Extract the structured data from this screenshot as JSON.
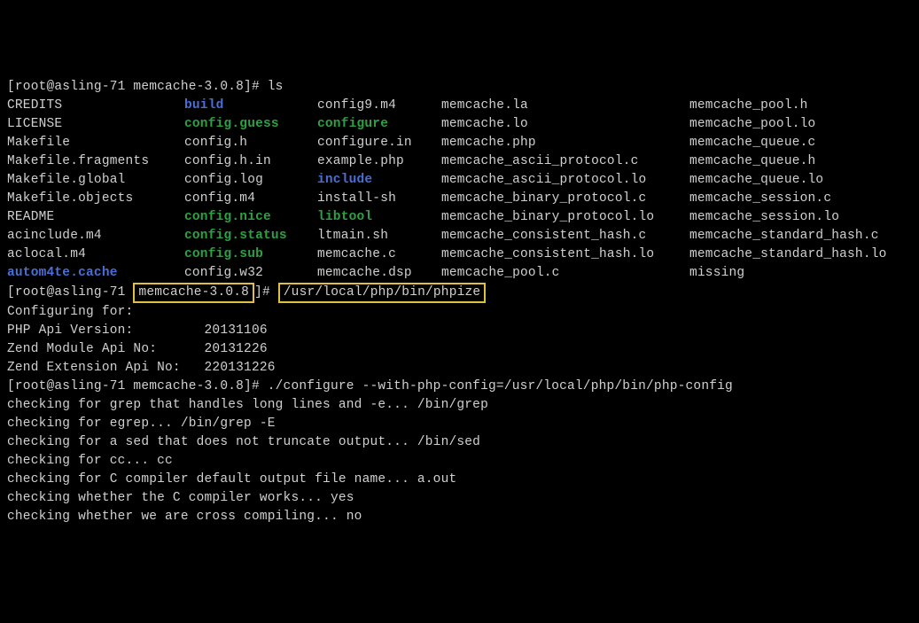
{
  "prompt1": {
    "user": "root",
    "host": "asling-71",
    "dir": "memcache-3.0.8",
    "cmd": "ls"
  },
  "ls": [
    [
      {
        "t": "CREDITS"
      },
      {
        "t": "build",
        "c": "blue"
      },
      {
        "t": "config9.m4"
      },
      {
        "t": "memcache.la"
      },
      {
        "t": "memcache_pool.h"
      }
    ],
    [
      {
        "t": "LICENSE"
      },
      {
        "t": "config.guess",
        "c": "green"
      },
      {
        "t": "configure",
        "c": "green"
      },
      {
        "t": "memcache.lo"
      },
      {
        "t": "memcache_pool.lo"
      }
    ],
    [
      {
        "t": "Makefile"
      },
      {
        "t": "config.h"
      },
      {
        "t": "configure.in"
      },
      {
        "t": "memcache.php"
      },
      {
        "t": "memcache_queue.c"
      }
    ],
    [
      {
        "t": "Makefile.fragments"
      },
      {
        "t": "config.h.in"
      },
      {
        "t": "example.php"
      },
      {
        "t": "memcache_ascii_protocol.c"
      },
      {
        "t": "memcache_queue.h"
      }
    ],
    [
      {
        "t": "Makefile.global"
      },
      {
        "t": "config.log"
      },
      {
        "t": "include",
        "c": "blue"
      },
      {
        "t": "memcache_ascii_protocol.lo"
      },
      {
        "t": "memcache_queue.lo"
      }
    ],
    [
      {
        "t": "Makefile.objects"
      },
      {
        "t": "config.m4"
      },
      {
        "t": "install-sh"
      },
      {
        "t": "memcache_binary_protocol.c"
      },
      {
        "t": "memcache_session.c"
      }
    ],
    [
      {
        "t": "README"
      },
      {
        "t": "config.nice",
        "c": "green"
      },
      {
        "t": "libtool",
        "c": "green"
      },
      {
        "t": "memcache_binary_protocol.lo"
      },
      {
        "t": "memcache_session.lo"
      }
    ],
    [
      {
        "t": "acinclude.m4"
      },
      {
        "t": "config.status",
        "c": "green"
      },
      {
        "t": "ltmain.sh"
      },
      {
        "t": "memcache_consistent_hash.c"
      },
      {
        "t": "memcache_standard_hash.c"
      }
    ],
    [
      {
        "t": "aclocal.m4"
      },
      {
        "t": "config.sub",
        "c": "green"
      },
      {
        "t": "memcache.c"
      },
      {
        "t": "memcache_consistent_hash.lo"
      },
      {
        "t": "memcache_standard_hash.lo"
      }
    ],
    [
      {
        "t": "autom4te.cache",
        "c": "blue"
      },
      {
        "t": "config.w32"
      },
      {
        "t": "memcache.dsp"
      },
      {
        "t": "memcache_pool.c"
      },
      {
        "t": "missing"
      }
    ]
  ],
  "phpize": {
    "prompt_pre": "[root@asling-71 ",
    "dir": "memcache-3.0.8",
    "prompt_mid": "]# ",
    "cmd": "/usr/local/php/bin/phpize",
    "out": [
      "Configuring for:",
      "PHP Api Version:         20131106",
      "Zend Module Api No:      20131226",
      "Zend Extension Api No:   220131226"
    ]
  },
  "conf": {
    "prompt": "[root@asling-71 memcache-3.0.8]# ",
    "cmd": "./configure --with-php-config=/usr/local/php/bin/php-config",
    "out": [
      "checking for grep that handles long lines and -e... /bin/grep",
      "checking for egrep... /bin/grep -E",
      "checking for a sed that does not truncate output... /bin/sed",
      "checking for cc... cc",
      "checking for C compiler default output file name... a.out",
      "checking whether the C compiler works... yes",
      "checking whether we are cross compiling... no"
    ]
  }
}
